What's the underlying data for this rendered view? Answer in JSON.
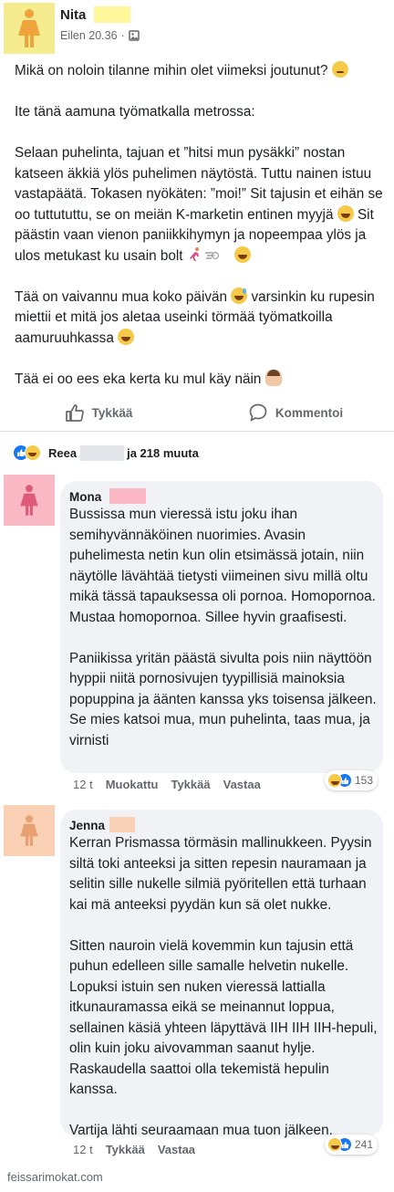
{
  "post": {
    "author": "Nita",
    "timestamp": "Eilen 20.36",
    "colors": {
      "avatar_bg": "#f5ec8f",
      "avatar_figure": "#f0a33a",
      "name_censor": "#fff79a"
    },
    "paragraphs": {
      "p1": "Mikä on noloin tilanne mihin olet viimeksi joutunut?",
      "p2": "Ite tänä aamuna työmatkalla metrossa:",
      "p3a": "Selaan puhelinta, tajuan et ”hitsi mun pysäkki” nostan katseen äkkiä ylös puhelimen näytöstä. Tuttu nainen istuu vastapäätä. Tokasen nyökäten: ”moi!” Sit tajusin et eihän se oo tuttututtu, se on meiän K-marketin entinen myyjä",
      "p3b": " Sit päästin vaan vienon paniikkihymyn ja  nopeempaa ylös ja ulos metukast ku usain bolt ",
      "p4a": "Tää on vaivannu mua koko päivän",
      "p4b": " varsinkin ku rupesin miettii et mitä jos aletaa useinki törmää työmatkoilla aamuruuhkassa ",
      "p5": "Tää ei oo ees eka kerta ku mul käy näin "
    },
    "actions": {
      "like": "Tykkää",
      "comment": "Kommentoi"
    }
  },
  "reactions": {
    "name": "Reea",
    "suffix": "ja 218 muuta"
  },
  "comments": [
    {
      "author": "Mona",
      "avatar_bg": "#f9b8c4",
      "figure_color": "#e05a7a",
      "censor_color": "#f9b8c4",
      "p1": "Bussissa mun vieressä istu joku ihan semihyvännäköinen nuorimies. Avasin puhelimesta netin kun olin etsimässä jotain, niin näytölle lävähtää tietysti viimeinen sivu millä oltu mikä tässä tapauksessa oli pornoa. Homopornoa. Mustaa homopornoa. Sillee hyvin graafisesti.",
      "p2": "Paniikissa yritän päästä sivulta pois niin näyttöön hyppii niitä pornosivujen tyypillisiä mainoksia popuppina ja äänten kanssa yks toisensa jälkeen. Se mies katsoi mua, mun puhelinta, taas mua, ja virnisti",
      "age": "12 t",
      "edited": "Muokattu",
      "like": "Tykkää",
      "reply": "Vastaa",
      "reaction_count": "153"
    },
    {
      "author": "Jenna",
      "avatar_bg": "#fad1b4",
      "figure_color": "#e9a070",
      "censor_color": "#fad1b4",
      "p1": "Kerran Prismassa törmäsin mallinukkeen. Pyysin siltä toki anteeksi ja sitten repesin nauramaan ja selitin sille nukelle silmiä pyöritellen että turhaan kai mä anteeksi pyydän kun sä olet nukke.",
      "p2": "Sitten nauroin vielä kovemmin kun tajusin että puhun edelleen sille samalle helvetin nukelle. Lopuksi istuin sen nuken vieressä lattialla itkunauramassa eikä se meinannut loppua, sellainen käsiä yhteen läpyttävä IIH IIH IIH-hepuli, olin kuin joku aivovamman saanut hylje. Raskaudella saattoi olla tekemistä hepulin kanssa.",
      "p3": "Vartija lähti seuraamaan mua tuon jälkeen.",
      "age": "12 t",
      "like": "Tykkää",
      "reply": "Vastaa",
      "reaction_count": "241"
    }
  ],
  "watermark": "feissarimokat.com"
}
